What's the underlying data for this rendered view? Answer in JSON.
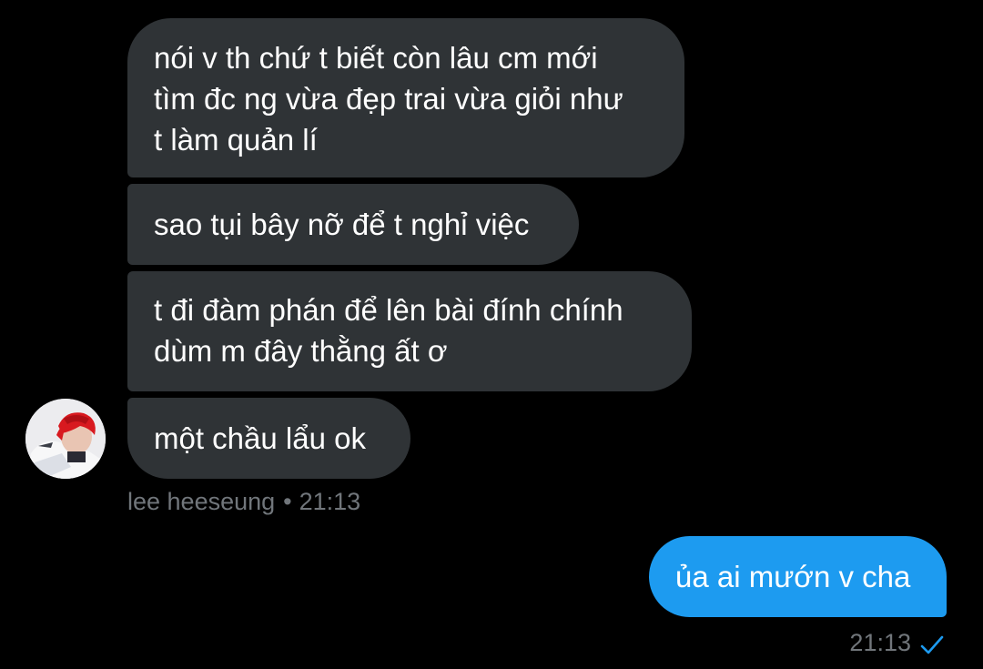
{
  "conversation": {
    "incoming": [
      {
        "lines": [
          "nói v th chứ t biết còn lâu cm mới",
          "tìm đc ng vừa đẹp trai vừa giỏi như",
          "t làm quản lí"
        ]
      },
      {
        "lines": [
          "sao tụi bây nỡ để t nghỉ việc"
        ]
      },
      {
        "lines": [
          "t đi đàm phán để lên bài đính chính",
          "dùm m đây thằng ất ơ"
        ]
      },
      {
        "lines": [
          "một chầu lẩu ok"
        ]
      }
    ],
    "incoming_meta": {
      "sender": "lee heeseung",
      "separator": "•",
      "time": "21:13"
    },
    "outgoing": [
      {
        "lines": [
          "ủa ai mướn v cha"
        ]
      }
    ],
    "outgoing_meta": {
      "time": "21:13",
      "status_icon": "check-icon"
    }
  },
  "colors": {
    "background": "#000000",
    "incoming_bubble": "#2f3336",
    "outgoing_bubble": "#1d9bf0",
    "text": "#ffffff",
    "meta_text": "#71767b",
    "read_check": "#1d9bf0"
  },
  "avatar": {
    "icon": "avatar-image",
    "hair_color": "#d8191f"
  }
}
